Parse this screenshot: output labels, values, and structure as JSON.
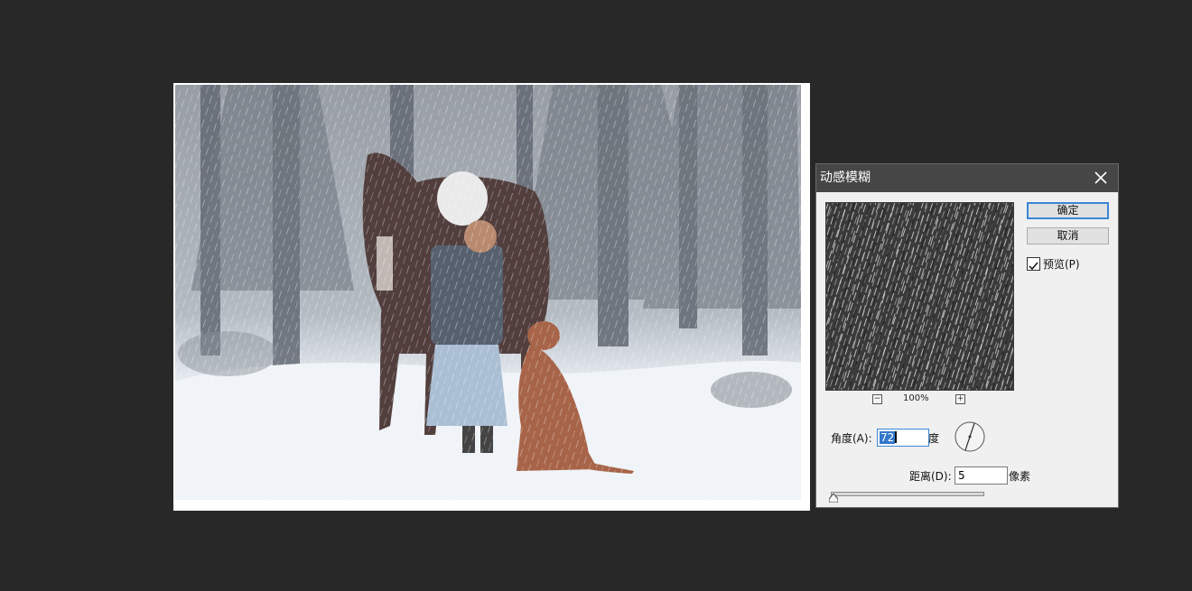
{
  "dialog": {
    "title": "动感模糊",
    "ok_label": "确定",
    "cancel_label": "取消",
    "preview_label": "预览(P)",
    "preview_checked": true,
    "zoom": {
      "value": "100%",
      "minus": "−",
      "plus": "+"
    },
    "angle": {
      "label": "角度(A):",
      "value": "72",
      "unit": "度"
    },
    "distance": {
      "label": "距离(D):",
      "value": "5",
      "unit": "像素",
      "slider_fraction": 0.0
    }
  },
  "icons": {
    "close": "close-icon",
    "checkmark": "checkmark-icon",
    "dial": "angle-dial-icon"
  },
  "colors": {
    "workspace": "#282828",
    "titlebar": "#464646",
    "dialog": "#f0f0f0",
    "accent": "#3b86d6"
  }
}
